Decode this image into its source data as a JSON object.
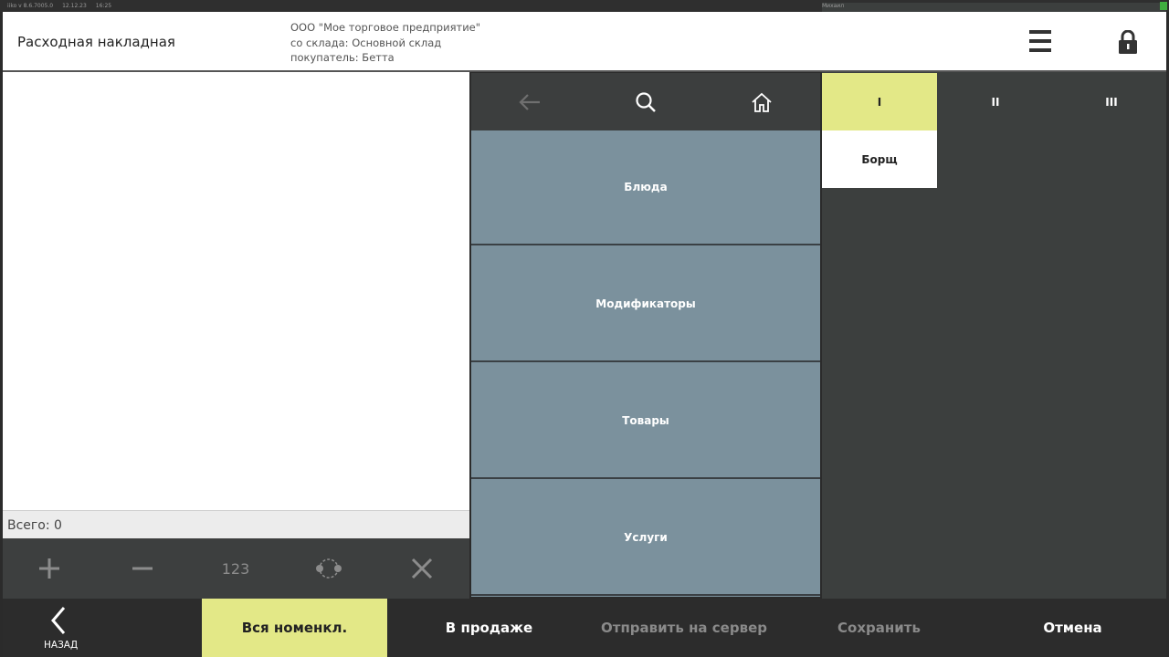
{
  "status": {
    "version": "iiko v 8.6.7005.0",
    "date": "12.12.23",
    "time": "16:25",
    "user": "Михаил"
  },
  "header": {
    "title": "Расходная накладная",
    "company": "ООО \"Мое торговое предприятие\"",
    "warehouse": "со склада: Основной склад",
    "buyer": "покупатель: Бетта"
  },
  "left": {
    "total": "Всего: 0",
    "tools": {
      "numpad": "123"
    }
  },
  "categories": [
    "Блюда",
    "Модификаторы",
    "Товары",
    "Услуги"
  ],
  "tabs": [
    "I",
    "II",
    "III"
  ],
  "items": [
    "Борщ"
  ],
  "bottom": {
    "back": "НАЗАД",
    "all": "Вся номенкл.",
    "on_sale": "В продаже",
    "send": "Отправить на сервер",
    "save": "Сохранить",
    "cancel": "Отмена"
  },
  "colors": {
    "accent": "#e3e887",
    "category": "#7b919d",
    "panel": "#3c3e3e"
  }
}
